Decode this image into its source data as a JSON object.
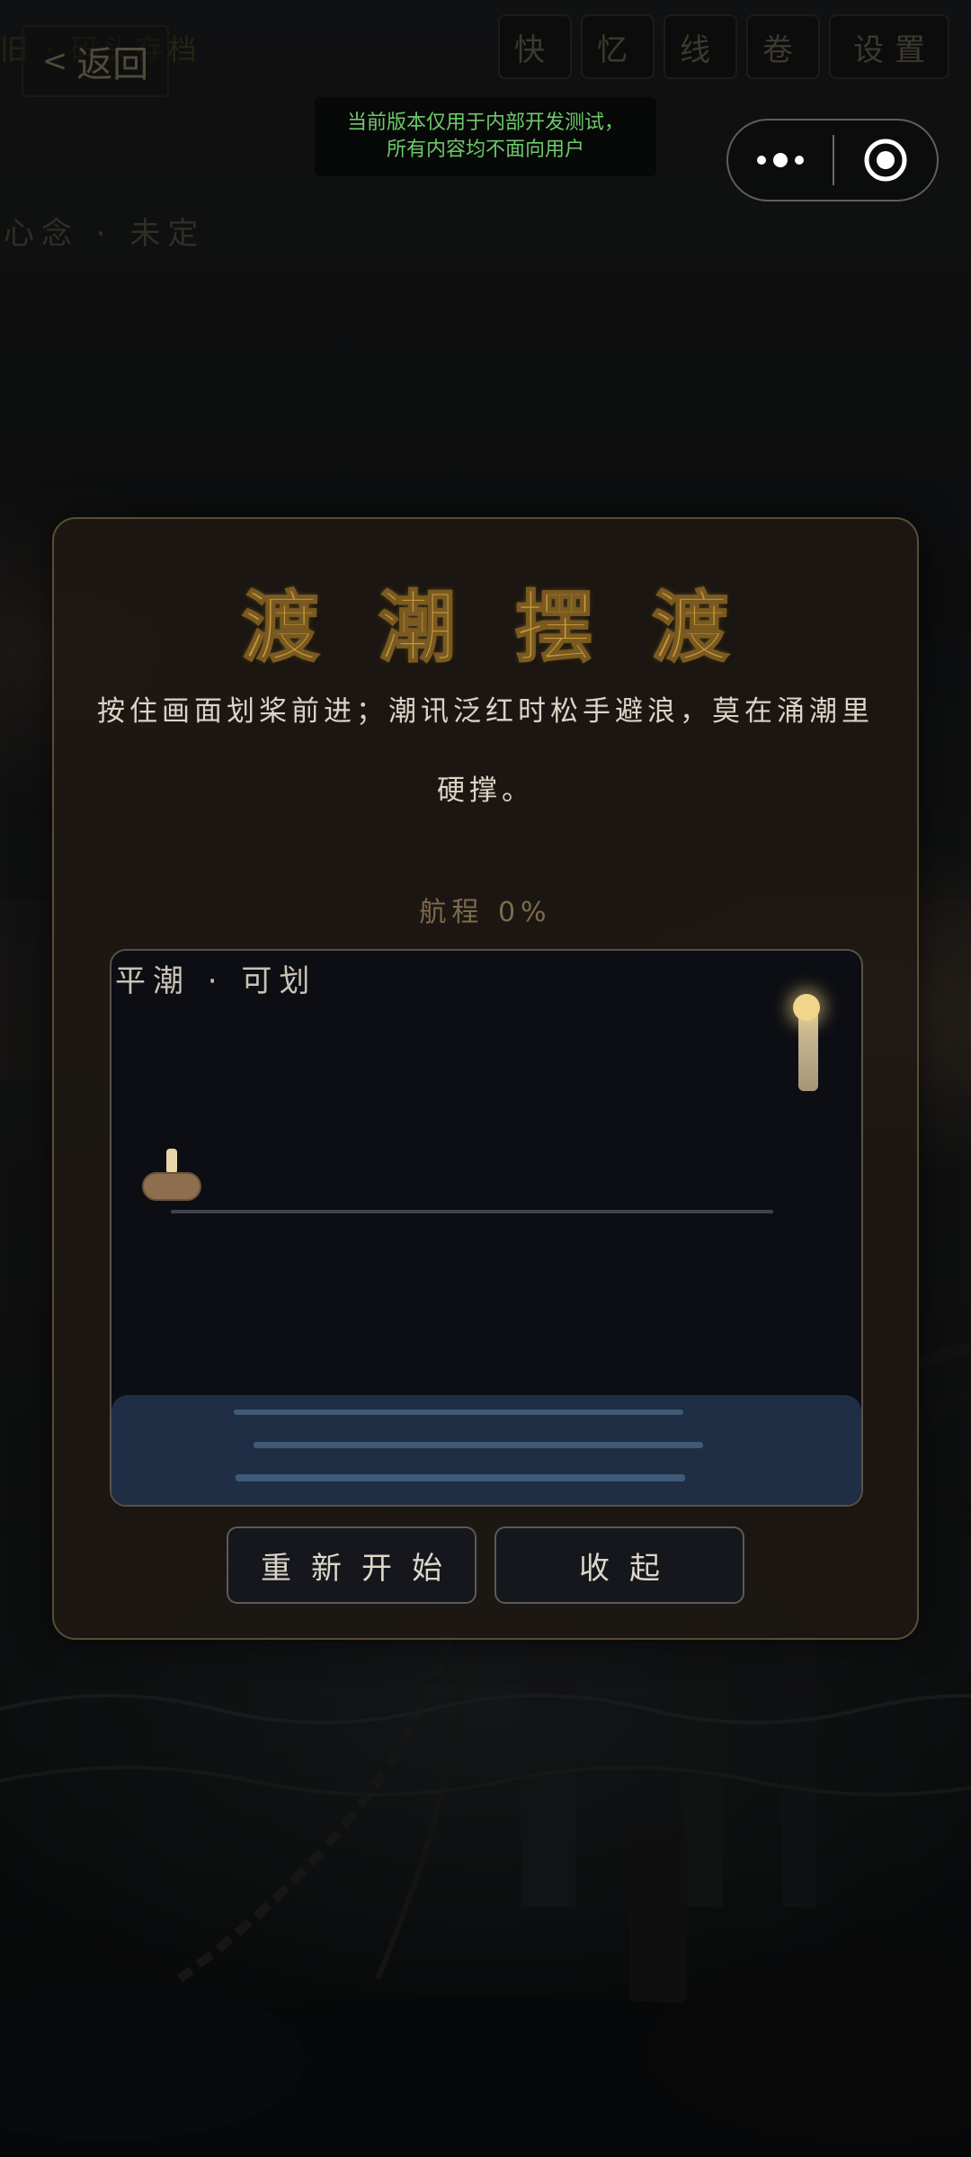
{
  "header": {
    "title": "旧 · 码头存档",
    "back_label": "返回",
    "back_icon": "chevron-left-icon",
    "tabs": [
      "快",
      "忆",
      "线",
      "卷",
      "设置"
    ]
  },
  "dev_notice": {
    "line1": "当前版本仅用于内部开发测试，",
    "line2": "所有内容均不面向用户"
  },
  "capsule": {
    "more_icon": "more-dots-icon",
    "close_icon": "target-circle-icon"
  },
  "status": {
    "mind_state": "心念 · 未定"
  },
  "modal": {
    "title": "渡潮摆渡",
    "description": "按住画面划桨前进；潮讯泛红时松手避浪，莫在涌潮里硬撑。",
    "progress_label": "航程",
    "progress_value": "0%",
    "tide_status": "平潮 · 可划",
    "restart_label": "重新开始",
    "close_label": "收起"
  },
  "game": {
    "voyage_progress": 0,
    "colors": {
      "water": "#1f2e44",
      "boat": "#8d6f4f",
      "lamp": "#f0d58a"
    }
  }
}
